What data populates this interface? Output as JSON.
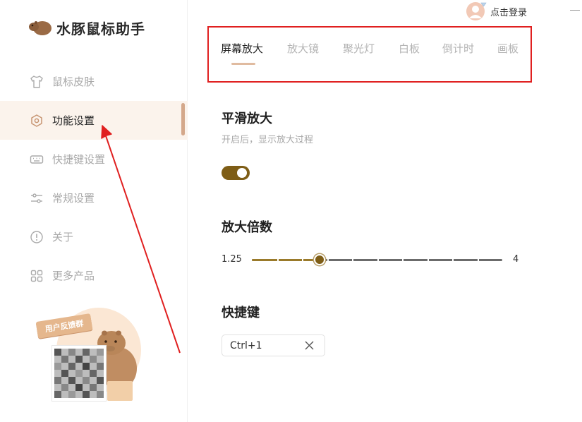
{
  "app": {
    "name": "水豚鼠标助手",
    "login_label": "点击登录"
  },
  "sidebar": {
    "items": [
      {
        "label": "鼠标皮肤",
        "icon": "tshirt-icon",
        "active": false
      },
      {
        "label": "功能设置",
        "icon": "hexagon-settings-icon",
        "active": true
      },
      {
        "label": "快捷键设置",
        "icon": "keyboard-icon",
        "active": false
      },
      {
        "label": "常规设置",
        "icon": "sliders-icon",
        "active": false
      },
      {
        "label": "关于",
        "icon": "info-icon",
        "active": false
      },
      {
        "label": "更多产品",
        "icon": "grid-icon",
        "active": false
      }
    ],
    "promo_sign": "用户反馈群"
  },
  "tabs": [
    {
      "label": "屏幕放大",
      "active": true
    },
    {
      "label": "放大镜",
      "active": false
    },
    {
      "label": "聚光灯",
      "active": false
    },
    {
      "label": "白板",
      "active": false
    },
    {
      "label": "倒计时",
      "active": false
    },
    {
      "label": "画板",
      "active": false
    }
  ],
  "smooth_zoom": {
    "title": "平滑放大",
    "description": "开启后，显示放大过程",
    "enabled": true
  },
  "zoom_factor": {
    "title": "放大倍数",
    "min_label": "1.25",
    "max_label": "4",
    "position_fraction": 0.27,
    "tick_count": 11
  },
  "hotkey": {
    "title": "快捷键",
    "value": "Ctrl+1"
  },
  "colors": {
    "accent": "#7e5d16",
    "annotation": "#e02020",
    "active_nav_bg": "#fbf3ec"
  }
}
